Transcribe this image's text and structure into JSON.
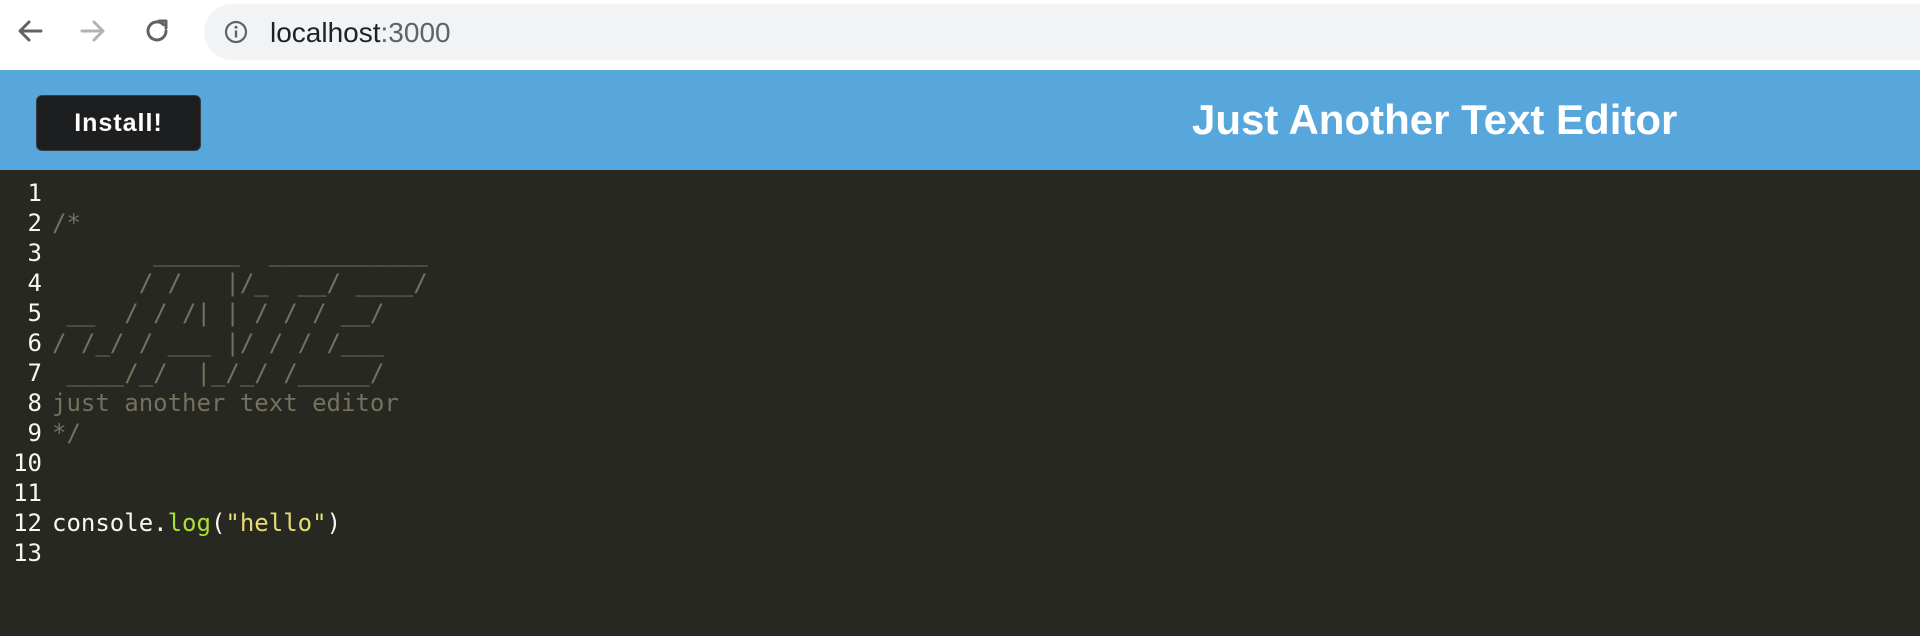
{
  "browser": {
    "url_host": "localhost",
    "url_port": ":3000",
    "icons": {
      "back": "arrow-left-icon",
      "forward": "arrow-right-icon",
      "reload": "reload-icon",
      "info": "info-icon"
    }
  },
  "header": {
    "install_label": "Install!",
    "title": "Just Another Text Editor",
    "background_color": "#57a6dc",
    "button_color": "#1c1e20"
  },
  "editor": {
    "theme": "monokai",
    "background_color": "#272822",
    "lines": [
      {
        "number": "1",
        "tokens": []
      },
      {
        "number": "2",
        "tokens": [
          {
            "type": "comment",
            "text": "/*"
          }
        ]
      },
      {
        "number": "3",
        "tokens": [
          {
            "type": "comment",
            "text": "       ______  ___________"
          }
        ]
      },
      {
        "number": "4",
        "tokens": [
          {
            "type": "comment",
            "text": "      / /   |/_  __/ ____/"
          }
        ]
      },
      {
        "number": "5",
        "tokens": [
          {
            "type": "comment",
            "text": " __  / / /| | / / / __/"
          }
        ]
      },
      {
        "number": "6",
        "tokens": [
          {
            "type": "comment",
            "text": "/ /_/ / ___ |/ / / /___"
          }
        ]
      },
      {
        "number": "7",
        "tokens": [
          {
            "type": "comment",
            "text": " ____/_/  |_/_/ /_____/"
          }
        ]
      },
      {
        "number": "8",
        "tokens": [
          {
            "type": "comment",
            "text": "just another text editor"
          }
        ]
      },
      {
        "number": "9",
        "tokens": [
          {
            "type": "comment",
            "text": "*/"
          }
        ]
      },
      {
        "number": "10",
        "tokens": []
      },
      {
        "number": "11",
        "tokens": []
      },
      {
        "number": "12",
        "tokens": [
          {
            "type": "plain",
            "text": "console."
          },
          {
            "type": "fn",
            "text": "log"
          },
          {
            "type": "plain",
            "text": "("
          },
          {
            "type": "str",
            "text": "\"hello\""
          },
          {
            "type": "plain",
            "text": ")"
          }
        ]
      },
      {
        "number": "13",
        "tokens": []
      }
    ]
  }
}
